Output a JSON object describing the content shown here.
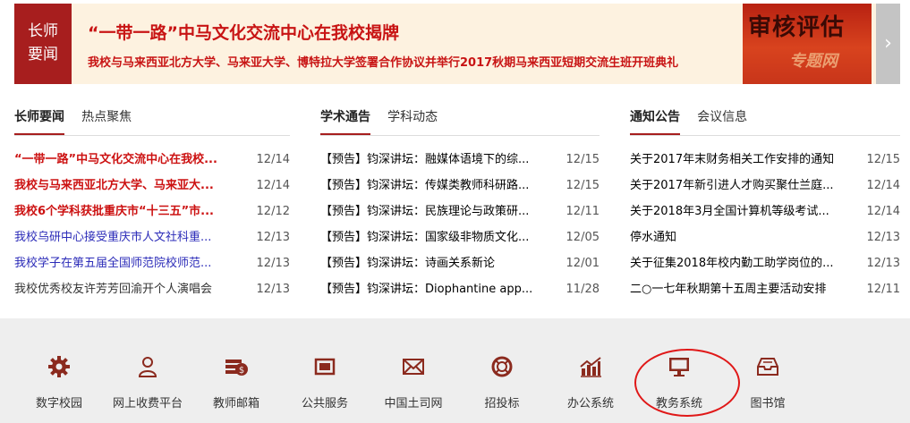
{
  "banner": {
    "tag_line1": "长师",
    "tag_line2": "要闻",
    "headline": "“一带一路”中马文化交流中心在我校揭牌",
    "subline": "我校与马来西亚北方大学、马来亚大学、博特拉大学签署合作协议并举行2017秋期马来西亚短期交流生班开班典礼",
    "image_text": "审核评估",
    "image_subtext": "专题网",
    "next_glyph": "›"
  },
  "columns": [
    {
      "tabs": [
        {
          "label": "长师要闻"
        },
        {
          "label": "热点聚焦"
        }
      ],
      "items": [
        {
          "title": "“一带一路”中马文化交流中心在我校...",
          "date": "12/14",
          "color": "#cc1111",
          "bold": true
        },
        {
          "title": "我校与马来西亚北方大学、马来亚大...",
          "date": "12/14",
          "color": "#cc1111",
          "bold": true
        },
        {
          "title": "我校6个学科获批重庆市“十三五”市...",
          "date": "12/12",
          "color": "#cc1111",
          "bold": true
        },
        {
          "title": "我校乌研中心接受重庆市人文社科重...",
          "date": "12/13",
          "color": "#2b2bb8",
          "bold": false
        },
        {
          "title": "我校学子在第五届全国师范院校师范...",
          "date": "12/13",
          "color": "#2b2bb8",
          "bold": false
        },
        {
          "title": "我校优秀校友许芳芳回渝开个人演唱会",
          "date": "12/13",
          "color": "#333333",
          "bold": false
        }
      ]
    },
    {
      "tabs": [
        {
          "label": "学术通告"
        },
        {
          "label": "学科动态"
        }
      ],
      "items": [
        {
          "title": "【预告】钧深讲坛：融媒体语境下的综...",
          "date": "12/15"
        },
        {
          "title": "【预告】钧深讲坛：传媒类教师科研路...",
          "date": "12/15"
        },
        {
          "title": "【预告】钧深讲坛：民族理论与政策研...",
          "date": "12/11"
        },
        {
          "title": "【预告】钧深讲坛：国家级非物质文化...",
          "date": "12/05"
        },
        {
          "title": "【预告】钧深讲坛：诗画关系新论",
          "date": "12/01"
        },
        {
          "title": "【预告】钧深讲坛：Diophantine app...",
          "date": "11/28"
        }
      ]
    },
    {
      "tabs": [
        {
          "label": "通知公告"
        },
        {
          "label": "会议信息"
        }
      ],
      "items": [
        {
          "title": "关于2017年末财务相关工作安排的通知",
          "date": "12/15"
        },
        {
          "title": "关于2017年新引进人才购买聚仕兰庭...",
          "date": "12/14"
        },
        {
          "title": "关于2018年3月全国计算机等级考试...",
          "date": "12/14"
        },
        {
          "title": "停水通知",
          "date": "12/13"
        },
        {
          "title": "关于征集2018年校内勤工助学岗位的...",
          "date": "12/13"
        },
        {
          "title": "二○一七年秋期第十五周主要活动安排",
          "date": "12/11"
        }
      ]
    }
  ],
  "quicklinks": [
    {
      "label": "数字校园",
      "icon": "gear-icon"
    },
    {
      "label": "网上收费平台",
      "icon": "user-icon"
    },
    {
      "label": "教师邮箱",
      "icon": "mail-money-icon"
    },
    {
      "label": "公共服务",
      "icon": "window-icon"
    },
    {
      "label": "中国土司网",
      "icon": "envelope-icon"
    },
    {
      "label": "招投标",
      "icon": "lifebuoy-icon"
    },
    {
      "label": "办公系统",
      "icon": "bar-chart-icon"
    },
    {
      "label": "教务系统",
      "icon": "monitor-icon"
    },
    {
      "label": "图书馆",
      "icon": "inbox-icon"
    }
  ],
  "colors": {
    "accent": "#a71e1e",
    "headline_red": "#c81414",
    "icon": "#8b2a1e",
    "annotation_circle": "#e01818"
  }
}
